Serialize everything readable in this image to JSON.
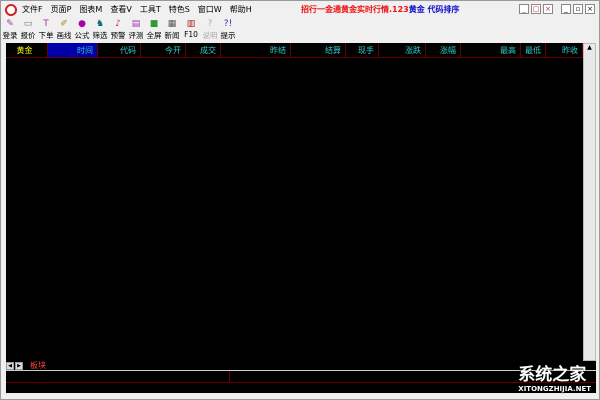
{
  "menu": [
    "文件F",
    "页面P",
    "图表M",
    "查看V",
    "工具T",
    "特色S",
    "窗口W",
    "帮助H"
  ],
  "title": {
    "red": "招行一金通黄金实时行情.123",
    "blue": "黄金 代码排序"
  },
  "toolbar": [
    {
      "icon": "✎",
      "label": "登录"
    },
    {
      "icon": "▭",
      "label": "报价"
    },
    {
      "icon": "T",
      "label": "下单"
    },
    {
      "icon": "✐",
      "label": "画线"
    },
    {
      "icon": "●",
      "label": "公式"
    },
    {
      "icon": "♞",
      "label": "筛选"
    },
    {
      "icon": "♪",
      "label": "预警"
    },
    {
      "icon": "▤",
      "label": "评测"
    },
    {
      "icon": "■",
      "label": "全屏"
    },
    {
      "icon": "▦",
      "label": "新闻"
    },
    {
      "icon": "▥",
      "label": "F10"
    },
    {
      "icon": "?",
      "label": "说明"
    },
    {
      "icon": "?!",
      "label": "提示"
    }
  ],
  "columns": [
    "黄金",
    "时间",
    "代码",
    "今开",
    "成交",
    "昨结",
    "结算",
    "现手",
    "涨跌",
    "涨幅",
    "最高",
    "最低",
    "昨收"
  ],
  "tab": "板块",
  "watermark": {
    "main": "系统之家",
    "sub": "XITONGZHIJIA.NET"
  }
}
